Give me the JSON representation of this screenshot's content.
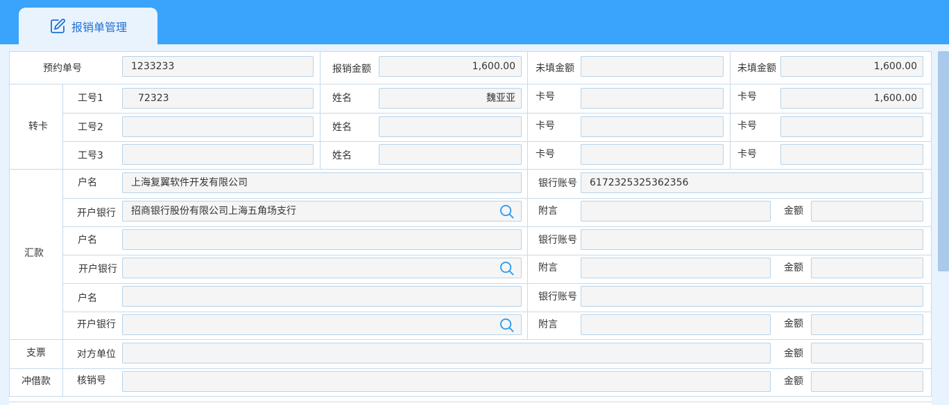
{
  "tab": {
    "label": "报销单管理",
    "icon": "edit-icon"
  },
  "row_reservation": {
    "label": "预约单号",
    "value": "1233233",
    "amount_label": "报销金额",
    "amount_value": "1,600.00",
    "unfilled_label_1": "未填金额",
    "unfilled_value_1": "",
    "unfilled_label_2": "未填金额",
    "unfilled_value_2": "1,600.00"
  },
  "transfer": {
    "section_label": "转卡",
    "rows": [
      {
        "id_label": "工号1",
        "id_value": "72323",
        "name_label": "姓名",
        "name_value": "魏亚亚",
        "card1_label": "卡号",
        "card1_value": "",
        "card2_label": "卡号",
        "card2_value": "1,600.00"
      },
      {
        "id_label": "工号2",
        "id_value": "",
        "name_label": "姓名",
        "name_value": "",
        "card1_label": "卡号",
        "card1_value": "",
        "card2_label": "卡号",
        "card2_value": ""
      },
      {
        "id_label": "工号3",
        "id_value": "",
        "name_label": "姓名",
        "name_value": "",
        "card1_label": "卡号",
        "card1_value": "",
        "card2_label": "卡号",
        "card2_value": ""
      }
    ]
  },
  "remittance": {
    "section_label": "汇款",
    "groups": [
      {
        "account_name_label": "户名",
        "account_name_value": "上海复翼软件开发有限公司",
        "account_no_label": "银行账号",
        "account_no_value": "6172325325362356",
        "bank_label": "开户银行",
        "bank_value": "招商银行股份有限公司上海五角场支行",
        "note_label": "附言",
        "note_value": "",
        "amount_label": "金额",
        "amount_value": ""
      },
      {
        "account_name_label": "户名",
        "account_name_value": "",
        "account_no_label": "银行账号",
        "account_no_value": "",
        "bank_label": "开户银行",
        "bank_value": "",
        "note_label": "附言",
        "note_value": "",
        "amount_label": "金额",
        "amount_value": ""
      },
      {
        "account_name_label": "户名",
        "account_name_value": "",
        "account_no_label": "银行账号",
        "account_no_value": "",
        "bank_label": "开户银行",
        "bank_value": "",
        "note_label": "附言",
        "note_value": "",
        "amount_label": "金额",
        "amount_value": ""
      }
    ]
  },
  "cheque": {
    "section_label": "支票",
    "party_label": "对方单位",
    "party_value": "",
    "amount_label": "金额",
    "amount_value": ""
  },
  "offset": {
    "section_label": "冲借款",
    "writeoff_label": "核销号",
    "writeoff_value": "",
    "amount_label": "金额",
    "amount_value": ""
  },
  "icons": {
    "search": "search-icon"
  },
  "colors": {
    "header": "#3aa3fb",
    "tab_text": "#1d6fd4",
    "border": "#b6d3ea",
    "background": "#e9f3fd"
  }
}
